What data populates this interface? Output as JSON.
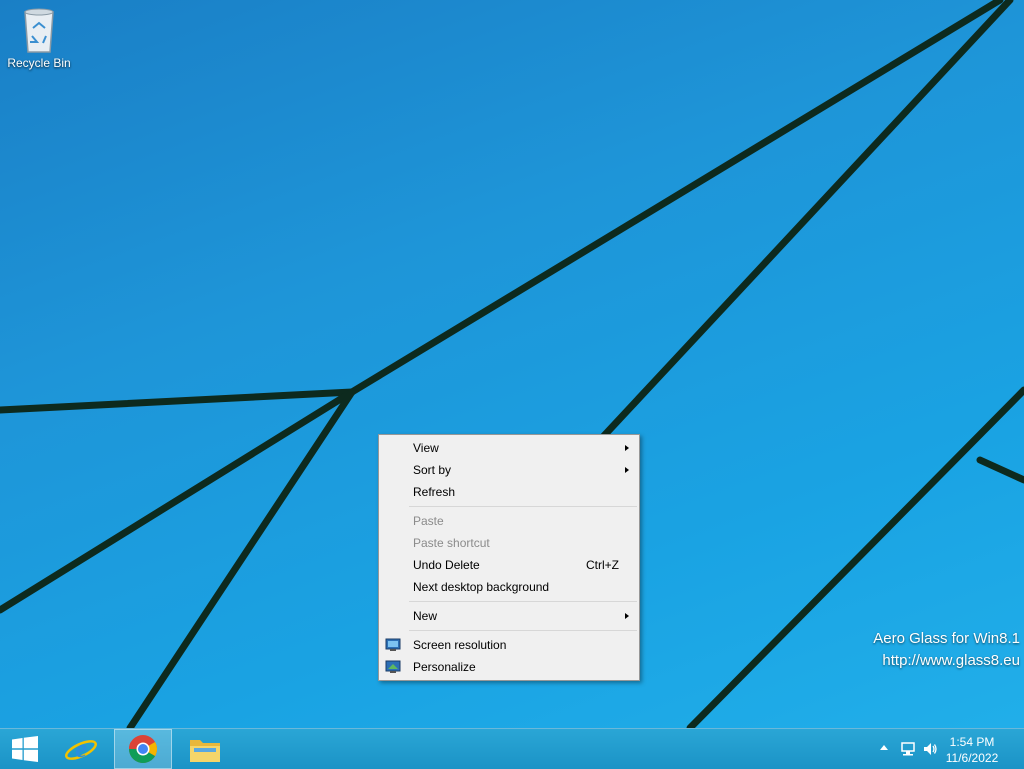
{
  "desktop": {
    "icons": [
      {
        "label": "Recycle Bin",
        "icon": "recycle-bin-icon"
      }
    ],
    "watermark": {
      "line1": "Aero Glass for Win8.1",
      "line2": "http://www.glass8.eu"
    }
  },
  "context_menu": {
    "items": [
      {
        "label": "View",
        "submenu": true
      },
      {
        "label": "Sort by",
        "submenu": true
      },
      {
        "label": "Refresh"
      },
      {
        "label": "Paste",
        "disabled": true
      },
      {
        "label": "Paste shortcut",
        "disabled": true
      },
      {
        "label": "Undo Delete",
        "shortcut": "Ctrl+Z"
      },
      {
        "label": "Next desktop background"
      },
      {
        "label": "New",
        "submenu": true
      },
      {
        "label": "Screen resolution",
        "icon": "monitor-icon"
      },
      {
        "label": "Personalize",
        "icon": "personalize-icon"
      }
    ]
  },
  "taskbar": {
    "buttons": [
      {
        "name": "start",
        "icon": "windows-logo-icon"
      },
      {
        "name": "internet-explorer",
        "icon": "ie-icon"
      },
      {
        "name": "chrome",
        "icon": "chrome-icon",
        "active": true
      },
      {
        "name": "file-explorer",
        "icon": "folder-icon"
      }
    ],
    "tray": {
      "clock_time": "1:54 PM",
      "clock_date": "11/6/2022"
    }
  },
  "colors": {
    "wallpaper": "#1e95d8",
    "menu_bg": "#f0f0f0",
    "taskbar": "#1b93c6"
  }
}
